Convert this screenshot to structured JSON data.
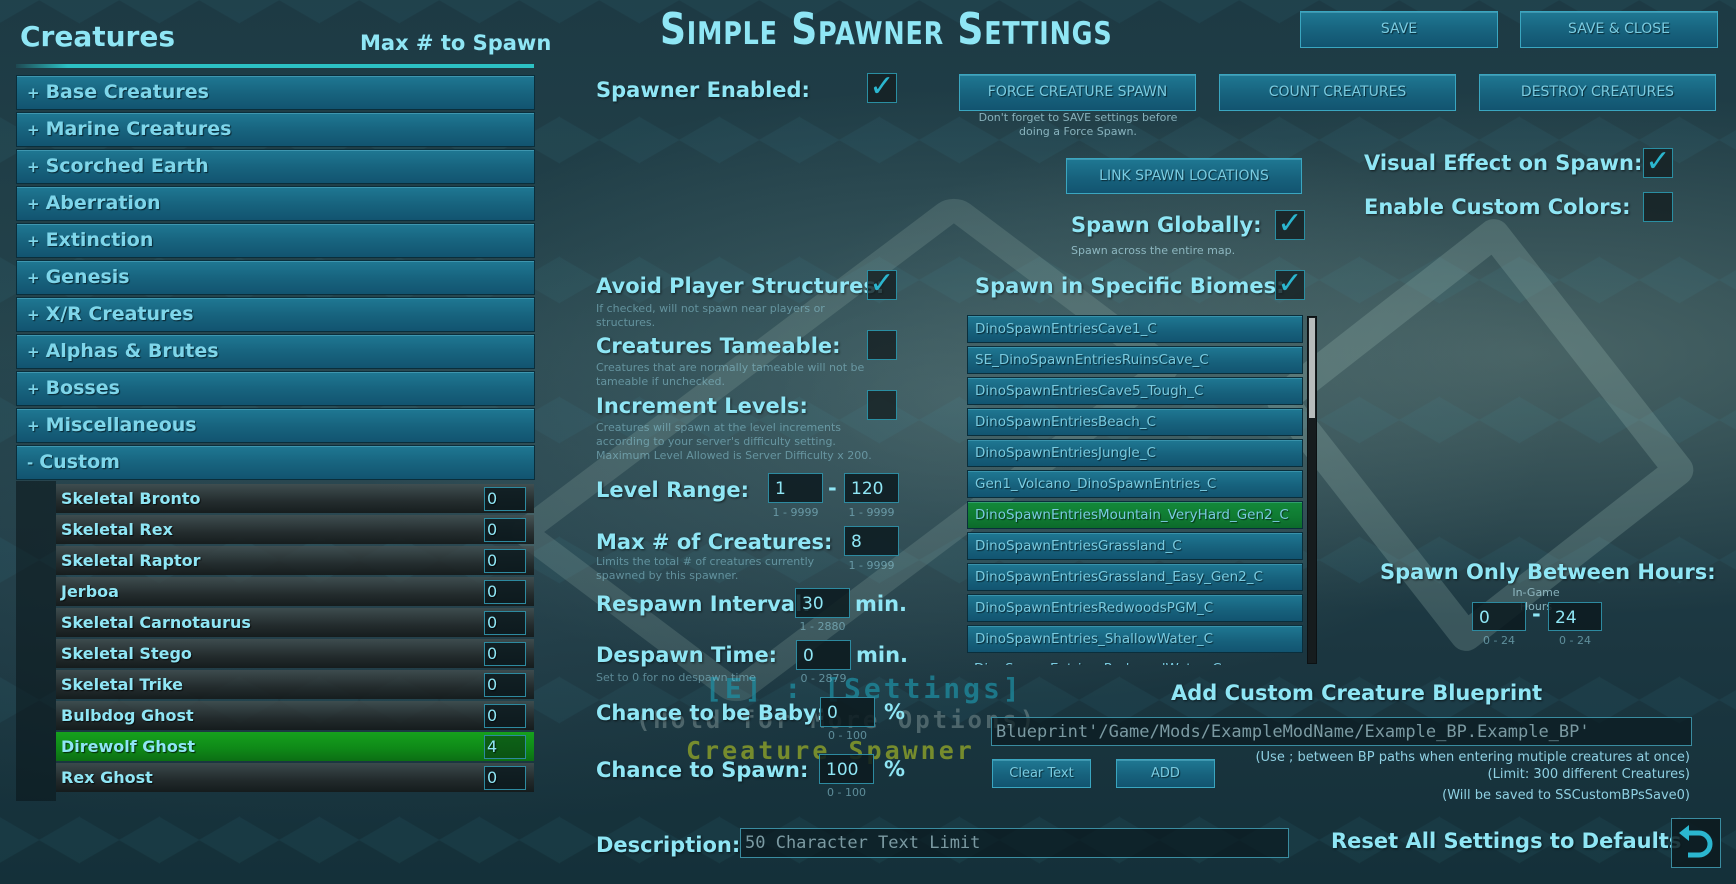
{
  "title": "Simple Spawner Settings",
  "left_panel": {
    "title": "Creatures",
    "column_header": "Max # to Spawn",
    "categories": [
      {
        "sign": "+",
        "label": "Base Creatures"
      },
      {
        "sign": "+",
        "label": "Marine Creatures"
      },
      {
        "sign": "+",
        "label": "Scorched Earth"
      },
      {
        "sign": "+",
        "label": "Aberration"
      },
      {
        "sign": "+",
        "label": "Extinction"
      },
      {
        "sign": "+",
        "label": "Genesis"
      },
      {
        "sign": "+",
        "label": "X/R Creatures"
      },
      {
        "sign": "+",
        "label": "Alphas & Brutes"
      },
      {
        "sign": "+",
        "label": "Bosses"
      },
      {
        "sign": "+",
        "label": "Miscellaneous"
      },
      {
        "sign": "-",
        "label": "Custom"
      }
    ],
    "custom_creatures": [
      {
        "name": "Skeletal Bronto",
        "max": "0",
        "selected": false
      },
      {
        "name": "Skeletal Rex",
        "max": "0",
        "selected": false
      },
      {
        "name": "Skeletal Raptor",
        "max": "0",
        "selected": false
      },
      {
        "name": "Jerboa",
        "max": "0",
        "selected": false
      },
      {
        "name": "Skeletal Carnotaurus",
        "max": "0",
        "selected": false
      },
      {
        "name": "Skeletal Stego",
        "max": "0",
        "selected": false
      },
      {
        "name": "Skeletal Trike",
        "max": "0",
        "selected": false
      },
      {
        "name": "Bulbdog Ghost",
        "max": "0",
        "selected": false
      },
      {
        "name": "Direwolf Ghost",
        "max": "4",
        "selected": true
      },
      {
        "name": "Rex Ghost",
        "max": "0",
        "selected": false
      }
    ]
  },
  "top_buttons": {
    "save": "SAVE",
    "save_close": "SAVE & CLOSE",
    "force_spawn": "FORCE CREATURE SPAWN",
    "count": "COUNT CREATURES",
    "destroy": "DESTROY CREATURES",
    "force_hint": "Don't forget to SAVE settings before doing a Force Spawn.",
    "link_spawn": "LINK SPAWN LOCATIONS"
  },
  "settings": {
    "spawner_enabled": {
      "label": "Spawner Enabled:",
      "checked": true
    },
    "avoid_structures": {
      "label": "Avoid Player Structures:",
      "hint": "If checked, will not spawn near players or structures.",
      "checked": true
    },
    "tameable": {
      "label": "Creatures Tameable:",
      "hint": "Creatures that are normally tameable will not be tameable if unchecked.",
      "checked": false
    },
    "increment_levels": {
      "label": "Increment Levels:",
      "hint": "Creatures will spawn at the level increments according to your server's difficulty setting. Maximum Level Allowed is Server Difficulty x 200.",
      "checked": false
    },
    "level_range": {
      "label": "Level Range:",
      "min": "1",
      "max": "120",
      "sep": "-",
      "min_range": "1 - 9999",
      "max_range": "1 - 9999"
    },
    "max_creatures": {
      "label": "Max # of Creatures:",
      "value": "8",
      "hint": "Limits the total # of creatures currently spawned by this spawner.",
      "range": "1 - 9999"
    },
    "respawn_interval": {
      "label": "Respawn Interval:",
      "value": "30",
      "unit": "min.",
      "range": "1 - 2880"
    },
    "despawn_time": {
      "label": "Despawn Time:",
      "value": "0",
      "unit": "min.",
      "hint": "Set to 0 for no despawn time",
      "range": "0 - 2879"
    },
    "baby_chance": {
      "label": "Chance to be Baby:",
      "value": "0",
      "unit": "%",
      "range": "0 - 100"
    },
    "spawn_chance": {
      "label": "Chance to Spawn:",
      "value": "100",
      "unit": "%",
      "range": "0 - 100"
    },
    "description": {
      "label": "Description:",
      "placeholder": "50 Character Text Limit",
      "value": ""
    },
    "spawn_globally": {
      "label": "Spawn Globally:",
      "hint": "Spawn across the entire map.",
      "checked": true
    },
    "specific_biomes": {
      "label": "Spawn in Specific Biomes:",
      "checked": true
    },
    "visual_effect": {
      "label": "Visual Effect on Spawn:",
      "checked": true
    },
    "custom_colors": {
      "label": "Enable Custom Colors:",
      "checked": false
    },
    "hours": {
      "label": "Spawn Only Between Hours:",
      "sub": "In-Game Hours",
      "from": "0",
      "to": "24",
      "sep": "-",
      "from_range": "0 - 24",
      "to_range": "0 - 24"
    }
  },
  "biomes": [
    {
      "name": "DinoSpawnEntriesCave1_C",
      "selected": false
    },
    {
      "name": "SE_DinoSpawnEntriesRuinsCave_C",
      "selected": false
    },
    {
      "name": "DinoSpawnEntriesCave5_Tough_C",
      "selected": false
    },
    {
      "name": "DinoSpawnEntriesBeach_C",
      "selected": false
    },
    {
      "name": "DinoSpawnEntriesJungle_C",
      "selected": false
    },
    {
      "name": "Gen1_Volcano_DinoSpawnEntries_C",
      "selected": false
    },
    {
      "name": "DinoSpawnEntriesMountain_VeryHard_Gen2_C",
      "selected": true
    },
    {
      "name": "DinoSpawnEntriesGrassland_C",
      "selected": false
    },
    {
      "name": "DinoSpawnEntriesGrassland_Easy_Gen2_C",
      "selected": false
    },
    {
      "name": "DinoSpawnEntriesRedwoodsPGM_C",
      "selected": false
    },
    {
      "name": "DinoSpawnEntries_ShallowWater_C",
      "selected": false
    },
    {
      "name": "DinoSpawnEntries_RedwoodWater_C",
      "selected": false
    }
  ],
  "custom_bp": {
    "title": "Add Custom Creature Blueprint",
    "placeholder": "Blueprint'/Game/Mods/ExampleModName/Example_BP.Example_BP'",
    "value": "",
    "clear_label": "Clear Text",
    "add_label": "ADD",
    "notes": [
      "(Use  ;  between BP paths when entering mutiple creatures at once)",
      "(Limit: 300 different Creatures)",
      "(Will be saved to SSCustomBPsSave0)"
    ]
  },
  "reset": {
    "label": "Reset All Settings to Defaults",
    "icon": "undo-icon"
  },
  "overlay": {
    "line1": "[E] : [Settings]",
    "line2": "(Hold for More Options)",
    "line3": "Creature Spawner"
  }
}
